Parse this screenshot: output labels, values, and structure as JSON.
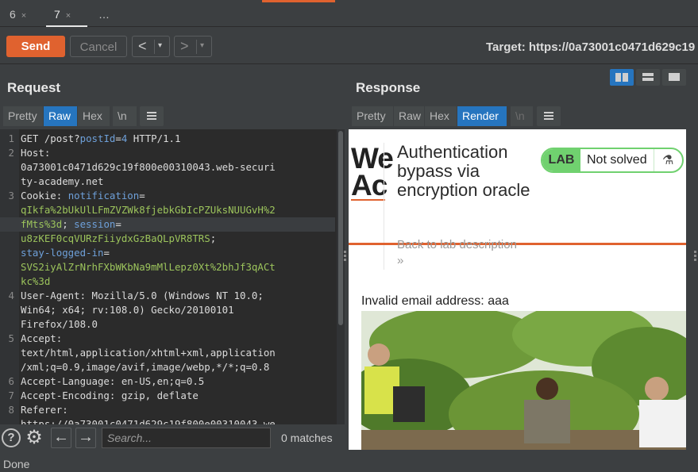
{
  "tabs": [
    {
      "label": "6",
      "close": "×",
      "active": false
    },
    {
      "label": "7",
      "close": "×",
      "active": true
    },
    {
      "label": "…",
      "close": "",
      "active": false
    }
  ],
  "toolbar": {
    "send_label": "Send",
    "cancel_label": "Cancel",
    "back_arrow": "<",
    "forward_arrow": ">",
    "dropdown": "▾",
    "target_label": "Target: https://0a73001c0471d629c19"
  },
  "request": {
    "title": "Request",
    "view_tabs": [
      "Pretty",
      "Raw",
      "Hex",
      "\\n"
    ],
    "active_tab": "Raw",
    "lines": [
      {
        "n": "1",
        "parts": [
          [
            "k",
            "GET /post?"
          ],
          [
            "blue",
            "postId"
          ],
          [
            "k",
            "="
          ],
          [
            "blue",
            "4"
          ],
          [
            "k",
            " HTTP/1.1"
          ]
        ]
      },
      {
        "n": "2",
        "parts": [
          [
            "k",
            "Host:"
          ]
        ]
      },
      {
        "n": "",
        "parts": [
          [
            "k",
            "0a73001c0471d629c19f800e00310043.web-securi"
          ]
        ]
      },
      {
        "n": "",
        "parts": [
          [
            "k",
            "ty-academy.net"
          ]
        ]
      },
      {
        "n": "3",
        "parts": [
          [
            "k",
            "Cookie: "
          ],
          [
            "blue",
            "notification"
          ],
          [
            "k",
            "="
          ]
        ]
      },
      {
        "n": "",
        "parts": [
          [
            "green",
            "qIkfa%2bUkUlLFmZVZWk8fjebkGbIcPZUksNUUGvH%2"
          ]
        ]
      },
      {
        "n": "",
        "hl": true,
        "parts": [
          [
            "green",
            "fMts%3d"
          ],
          [
            "k",
            "; "
          ],
          [
            "blue",
            "session"
          ],
          [
            "k",
            "="
          ]
        ]
      },
      {
        "n": "",
        "parts": [
          [
            "green",
            "u8zKEF0cqVURzFiiydxGzBaQLpVR8TRS"
          ],
          [
            "k",
            ";"
          ]
        ]
      },
      {
        "n": "",
        "parts": [
          [
            "blue",
            "stay-logged-in"
          ],
          [
            "k",
            "="
          ]
        ]
      },
      {
        "n": "",
        "parts": [
          [
            "green",
            "SVS2iyAlZrNrhFXbWKbNa9mMlLepz0Xt%2bhJf3qACt"
          ]
        ]
      },
      {
        "n": "",
        "parts": [
          [
            "green",
            "kc%3d"
          ]
        ]
      },
      {
        "n": "4",
        "parts": [
          [
            "k",
            "User-Agent: Mozilla/5.0 (Windows NT 10.0;"
          ]
        ]
      },
      {
        "n": "",
        "parts": [
          [
            "k",
            "Win64; x64; rv:108.0) Gecko/20100101"
          ]
        ]
      },
      {
        "n": "",
        "parts": [
          [
            "k",
            "Firefox/108.0"
          ]
        ]
      },
      {
        "n": "5",
        "parts": [
          [
            "k",
            "Accept:"
          ]
        ]
      },
      {
        "n": "",
        "parts": [
          [
            "k",
            "text/html,application/xhtml+xml,application"
          ]
        ]
      },
      {
        "n": "",
        "parts": [
          [
            "k",
            "/xml;q=0.9,image/avif,image/webp,*/*;q=0.8"
          ]
        ]
      },
      {
        "n": "6",
        "parts": [
          [
            "k",
            "Accept-Language: en-US,en;q=0.5"
          ]
        ]
      },
      {
        "n": "7",
        "parts": [
          [
            "k",
            "Accept-Encoding: gzip, deflate"
          ]
        ]
      },
      {
        "n": "8",
        "parts": [
          [
            "k",
            "Referer:"
          ]
        ]
      },
      {
        "n": "",
        "parts": [
          [
            "k",
            "https://0a73001c0471d629c19f800e00310043.we"
          ]
        ]
      }
    ]
  },
  "response": {
    "title": "Response",
    "view_tabs": [
      "Pretty",
      "Raw",
      "Hex",
      "Render",
      "\\n"
    ],
    "active_tab": "Render",
    "page": {
      "logo_text": "We\nAc",
      "lab_title": "Authentication bypass via encryption oracle",
      "lab_badge": "LAB",
      "lab_status": "Not solved",
      "flask_icon": "⚗",
      "back_link": "Back to lab description",
      "back_arrows": "»",
      "message": "Invalid email address: aaa"
    }
  },
  "search": {
    "help_icon": "?",
    "settings_icon": "⚙",
    "prev": "←",
    "next": "→",
    "placeholder": "Search...",
    "matches": "0 matches"
  },
  "status_text": "Done"
}
